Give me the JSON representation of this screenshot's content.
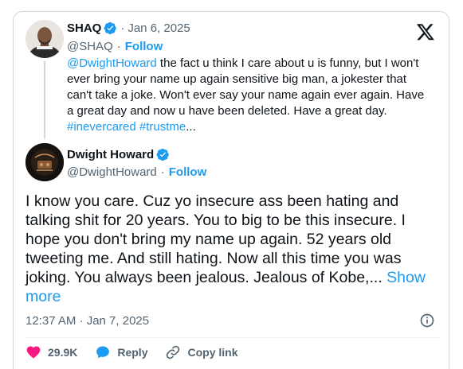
{
  "parent_tweet": {
    "author_name": "SHAQ",
    "date": "Jan 6, 2025",
    "handle": "@SHAQ",
    "follow_label": "Follow",
    "mention": "@DwightHoward",
    "text_body": " the fact u think I care about u is funny, but I won't ever bring your name up again sensitive big man, a jokester that can't take a joke. Won't ever say your name again ever again. Have a great day and now u have been deleted. Have a great day. ",
    "hashtag_1": "#inevercared",
    "hashtag_2": "#trustme",
    "ellipsis": "..."
  },
  "main_tweet": {
    "author_name": "Dwight Howard",
    "handle": "@DwightHoward",
    "follow_label": "Follow",
    "text": "I know you care. Cuz yo insecure ass been hating and talking shit for 20 years. You to big to be this insecure.  I hope you don't bring my name up again.  52 years old tweeting me.  And still hating. Now all this time you was joking.  You always been jealous.  Jealous of Kobe,... ",
    "show_more_label": "Show more",
    "timestamp": "12:37 AM · Jan 7, 2025"
  },
  "actions": {
    "like_count": "29.9K",
    "reply_label": "Reply",
    "copy_link_label": "Copy link"
  },
  "icons": {
    "verified": "verified-badge-icon",
    "x_logo": "x-logo-icon",
    "info": "info-icon",
    "heart": "heart-icon",
    "reply": "reply-bubble-icon",
    "link": "link-icon"
  },
  "colors": {
    "accent": "#1d9bf0",
    "like": "#f91880",
    "secondary_text": "#536471",
    "border": "#cfd9de"
  }
}
